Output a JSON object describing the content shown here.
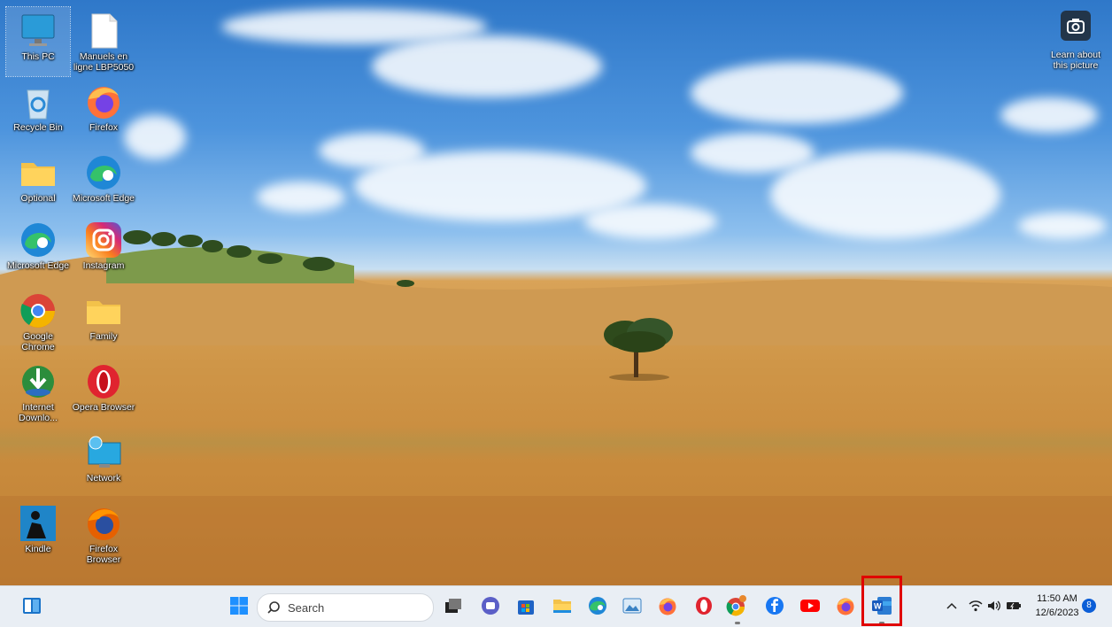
{
  "desktop": {
    "icons": [
      {
        "label": "This PC",
        "icon": "monitor-icon"
      },
      {
        "label": "Manuels en ligne LBP5050",
        "icon": "document-icon"
      },
      {
        "label": "Recycle Bin",
        "icon": "recycle-bin-icon"
      },
      {
        "label": "Firefox",
        "icon": "firefox-icon"
      },
      {
        "label": "Optional",
        "icon": "folder-icon"
      },
      {
        "label": "Microsoft Edge",
        "icon": "edge-icon"
      },
      {
        "label": "Microsoft Edge",
        "icon": "edge-icon"
      },
      {
        "label": "Instagram",
        "icon": "instagram-icon"
      },
      {
        "label": "Google Chrome",
        "icon": "chrome-icon"
      },
      {
        "label": "Family",
        "icon": "folder-icon"
      },
      {
        "label": "Internet Downlo...",
        "icon": "idm-icon"
      },
      {
        "label": "Opera Browser",
        "icon": "opera-icon"
      },
      {
        "label": "Network",
        "icon": "network-icon"
      },
      {
        "label": "Kindle",
        "icon": "kindle-icon"
      },
      {
        "label": "Firefox Browser",
        "icon": "firefox-icon"
      }
    ],
    "camera_widget": {
      "label": "Learn about this picture",
      "icon": "camera-icon"
    }
  },
  "taskbar": {
    "search_placeholder": "Search",
    "apps": [
      "widgets-icon",
      "start-icon",
      "task-view-icon",
      "teams-chat-icon",
      "store-icon",
      "file-explorer-icon",
      "edge-icon",
      "photos-icon",
      "firefox-icon",
      "opera-icon",
      "chrome-icon",
      "facebook-icon",
      "youtube-icon",
      "firefox-icon",
      "word-icon"
    ],
    "tray": {
      "time": "11:50 AM",
      "date": "12/6/2023",
      "notification_count": "8"
    }
  },
  "colors": {
    "highlight": "#e00000",
    "taskbar_bg": "#e9eef4",
    "accent": "#0078d4"
  }
}
